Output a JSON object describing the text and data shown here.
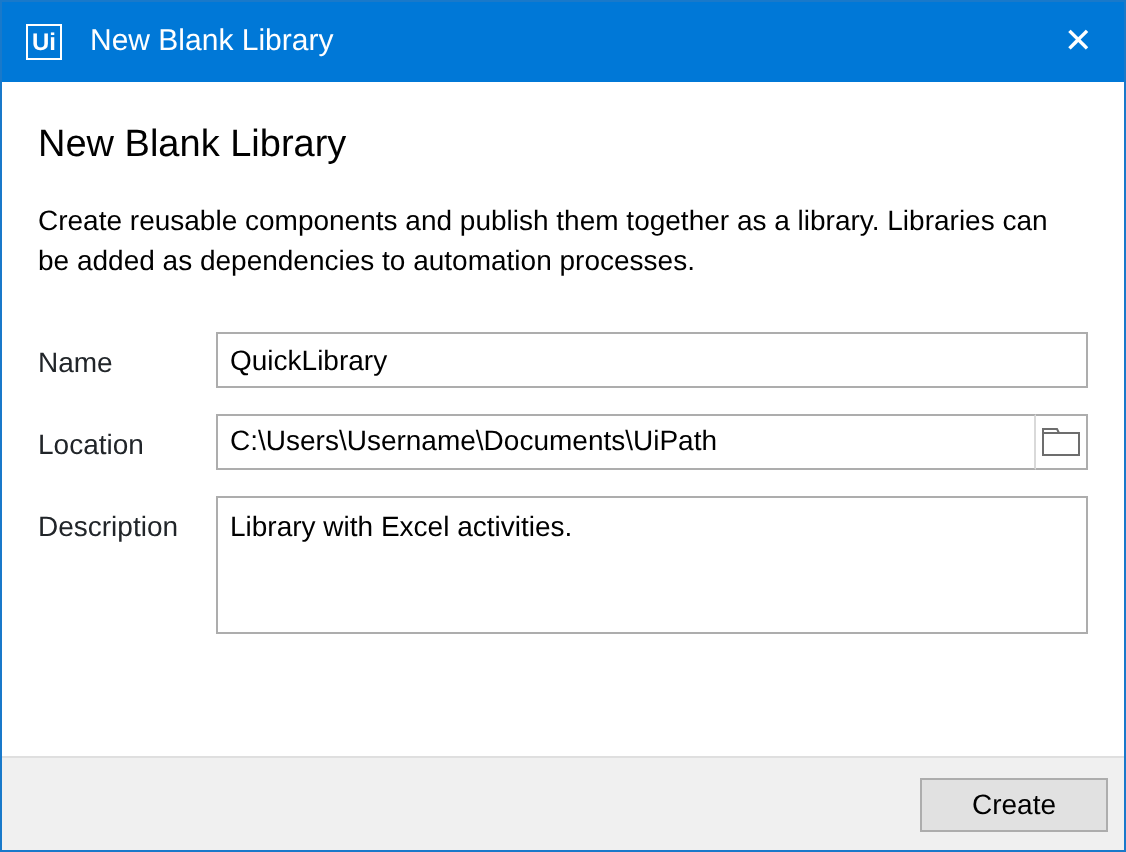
{
  "window": {
    "logo": "Ui",
    "title": "New Blank Library",
    "close": "✕"
  },
  "heading": "New Blank Library",
  "intro": "Create reusable components and publish them together as a library. Libraries can be added as dependencies to automation processes.",
  "fields": [
    {
      "kind": "text",
      "label": "Name",
      "value": "QuickLibrary"
    },
    {
      "kind": "folder",
      "label": "Location",
      "value": "C:\\Users\\Username\\Documents\\UiPath"
    },
    {
      "kind": "multiline",
      "label": "Description",
      "value": "Library with Excel activities."
    }
  ],
  "buttons": [
    "Create"
  ]
}
